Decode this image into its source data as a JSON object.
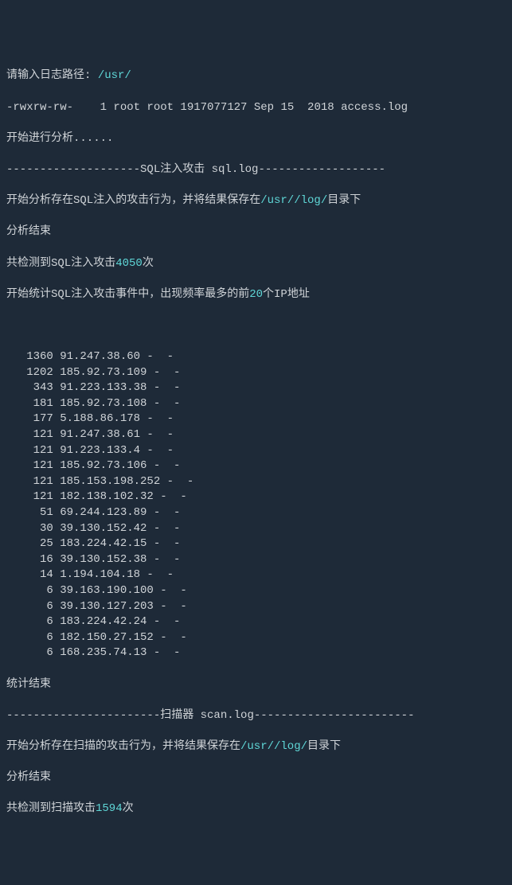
{
  "prompt": {
    "label": "请输入日志路径:",
    "value": "/usr/"
  },
  "file_listing": "-rwxrw-rw-    1 root root 1917077127 Sep 15  2018 access.log",
  "start_msg": "开始进行分析......",
  "sections": {
    "sql": {
      "divider": "--------------------SQL注入攻击 sql.log-------------------",
      "begin": "开始分析存在SQL注入的攻击行为，并将结果保存在",
      "save_path": "/usr//log/",
      "suffix": "目录下",
      "end": "分析结束",
      "detect_prefix": "共检测到SQL注入攻击",
      "detect_count": "4050",
      "detect_suffix": "次",
      "stats_prefix": "开始统计SQL注入攻击事件中，出现频率最多的前",
      "stats_n": "20",
      "stats_suffix": "个IP地址",
      "stats_end": "统计结束",
      "rows": [
        {
          "count": "1360",
          "ip": "91.247.38.60"
        },
        {
          "count": "1202",
          "ip": "185.92.73.109"
        },
        {
          "count": "343",
          "ip": "91.223.133.38"
        },
        {
          "count": "181",
          "ip": "185.92.73.108"
        },
        {
          "count": "177",
          "ip": "5.188.86.178"
        },
        {
          "count": "121",
          "ip": "91.247.38.61"
        },
        {
          "count": "121",
          "ip": "91.223.133.4"
        },
        {
          "count": "121",
          "ip": "185.92.73.106"
        },
        {
          "count": "121",
          "ip": "185.153.198.252"
        },
        {
          "count": "121",
          "ip": "182.138.102.32"
        },
        {
          "count": "51",
          "ip": "69.244.123.89"
        },
        {
          "count": "30",
          "ip": "39.130.152.42"
        },
        {
          "count": "25",
          "ip": "183.224.42.15"
        },
        {
          "count": "16",
          "ip": "39.130.152.38"
        },
        {
          "count": "14",
          "ip": "1.194.104.18"
        },
        {
          "count": "6",
          "ip": "39.163.190.100"
        },
        {
          "count": "6",
          "ip": "39.130.127.203"
        },
        {
          "count": "6",
          "ip": "183.224.42.24"
        },
        {
          "count": "6",
          "ip": "182.150.27.152"
        },
        {
          "count": "6",
          "ip": "168.235.74.13"
        }
      ]
    },
    "scan": {
      "divider": "-----------------------扫描器 scan.log------------------------",
      "begin": "开始分析存在扫描的攻击行为，并将结果保存在",
      "save_path": "/usr//log/",
      "suffix": "目录下",
      "end": "分析结束",
      "detect_prefix": "共检测到扫描攻击",
      "detect_count": "1594",
      "detect_suffix": "次"
    }
  }
}
